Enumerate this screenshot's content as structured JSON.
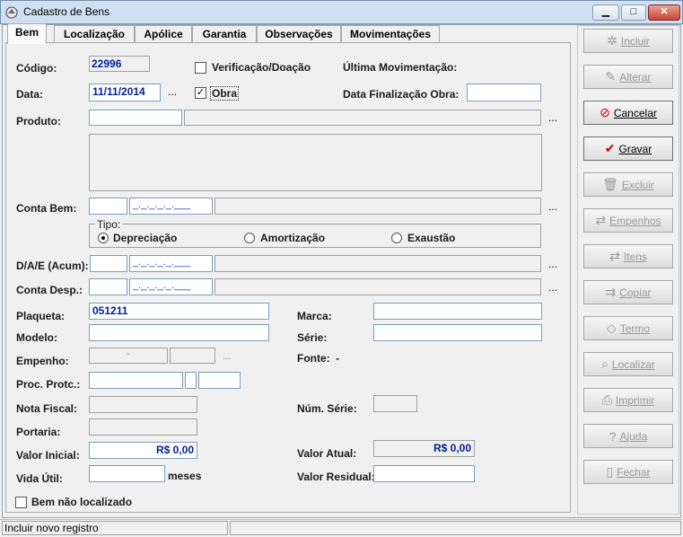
{
  "window": {
    "title": "Cadastro de Bens",
    "minimize": "▁",
    "maximize": "□",
    "close": "✕"
  },
  "tabs": [
    "Bem",
    "Localização",
    "Apólice",
    "Garantia",
    "Observações",
    "Movimentações"
  ],
  "form": {
    "codigo_label": "Código:",
    "codigo_value": "22996",
    "verificacao_label": "Verificação/Doação",
    "ultima_mov_label": "Última Movimentação:",
    "data_label": "Data:",
    "data_value": "11/11/2014",
    "data_dots": "...",
    "obra_label": "Obra",
    "obra_checked": "✓",
    "data_final_label": "Data Finalização Obra:",
    "produto_label": "Produto:",
    "produto_dots": "...",
    "conta_bem_label": "Conta Bem:",
    "conta_bem_mask": "_._._._._.___",
    "conta_bem_dots": "...",
    "tipo_label": "Tipo:",
    "tipo_options": [
      "Depreciação",
      "Amortização",
      "Exaustão"
    ],
    "dae_label": "D/A/E (Acum):",
    "dae_mask": "_._._._._.___",
    "dae_dots": "...",
    "conta_desp_label": "Conta Desp.:",
    "conta_desp_mask": "_._._._._.___",
    "conta_desp_dots": "...",
    "plaqueta_label": "Plaqueta:",
    "plaqueta_value": "051211",
    "marca_label": "Marca:",
    "modelo_label": "Modelo:",
    "serie_label": "Série:",
    "empenho_label": "Empenho:",
    "empenho_value": "-",
    "empenho_dots": "...",
    "fonte_label": "Fonte:",
    "fonte_value": "-",
    "proc_label": "Proc. Protc.:",
    "nota_label": "Nota Fiscal:",
    "num_serie_label": "Núm. Série:",
    "portaria_label": "Portaria:",
    "valor_inicial_label": "Valor Inicial:",
    "valor_inicial_value": "R$ 0,00",
    "valor_atual_label": "Valor Atual:",
    "valor_atual_value": "R$ 0,00",
    "vida_util_label": "Vida Útil:",
    "meses_label": "meses",
    "valor_residual_label": "Valor Residual:",
    "nao_localizado_label": "Bem não localizado"
  },
  "side_buttons": [
    {
      "label": "Incluir",
      "icon": "sparkle-icon",
      "glyph": "✲",
      "enabled": false
    },
    {
      "label": "Alterar",
      "icon": "edit-icon",
      "glyph": "✎",
      "enabled": false
    },
    {
      "label": "Cancelar",
      "icon": "cancel-icon",
      "glyph": "⊘",
      "enabled": true
    },
    {
      "label": "Gravar",
      "icon": "check-icon",
      "glyph": "✔",
      "enabled": true
    },
    {
      "label": "Excluir",
      "icon": "trash-icon",
      "glyph": "🗑",
      "enabled": false
    },
    {
      "label": "Empenhos",
      "icon": "link-icon",
      "glyph": "⇄",
      "enabled": false
    },
    {
      "label": "Itens",
      "icon": "items-icon",
      "glyph": "⇄",
      "enabled": false
    },
    {
      "label": "Copiar",
      "icon": "copy-icon",
      "glyph": "⇉",
      "enabled": false
    },
    {
      "label": "Termo",
      "icon": "tag-icon",
      "glyph": "◇",
      "enabled": false
    },
    {
      "label": "Localizar",
      "icon": "locate-icon",
      "glyph": "⌕",
      "enabled": false
    },
    {
      "label": "Imprimir",
      "icon": "printer-icon",
      "glyph": "⎙",
      "enabled": false
    },
    {
      "label": "Ajuda",
      "icon": "help-icon",
      "glyph": "?",
      "enabled": false
    },
    {
      "label": "Fechar",
      "icon": "door-icon",
      "glyph": "▯",
      "enabled": false
    }
  ],
  "status": {
    "message": "Incluir novo registro"
  },
  "colors": {
    "accent_blue": "#00219c",
    "cancel_red": "#cc0000",
    "gravar_red": "#cc0000"
  }
}
